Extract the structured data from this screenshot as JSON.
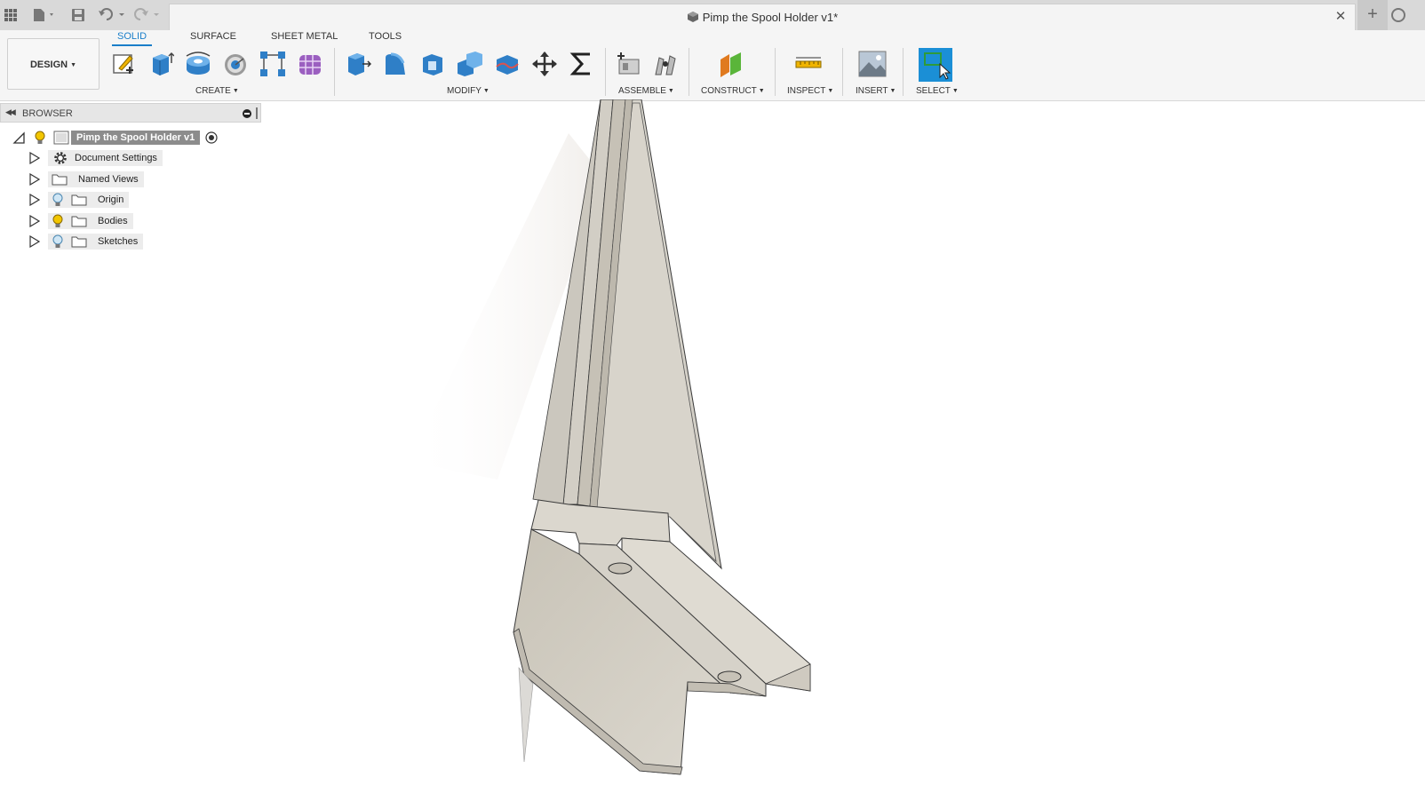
{
  "document": {
    "title": "Pimp the Spool Holder v1*",
    "close_glyph": "✕",
    "new_tab_glyph": "+"
  },
  "workspace": {
    "label": "DESIGN"
  },
  "ribbon": {
    "tabs": [
      {
        "label": "SOLID",
        "active": true
      },
      {
        "label": "SURFACE",
        "active": false
      },
      {
        "label": "SHEET METAL",
        "active": false
      },
      {
        "label": "TOOLS",
        "active": false
      }
    ],
    "groups": {
      "create": "CREATE",
      "modify": "MODIFY",
      "assemble": "ASSEMBLE",
      "construct": "CONSTRUCT",
      "inspect": "INSPECT",
      "insert": "INSERT",
      "select": "SELECT"
    },
    "accent_color": "#1a7ec9",
    "select_active_color": "#1b8fd6"
  },
  "browser": {
    "title": "BROWSER",
    "root": "Pimp the Spool Holder v1",
    "items": [
      {
        "label": "Document Settings",
        "icon": "gear-icon"
      },
      {
        "label": "Named Views",
        "icon": "folder-icon"
      },
      {
        "label": "Origin",
        "icon": "folder-icon"
      },
      {
        "label": "Bodies",
        "icon": "folder-icon"
      },
      {
        "label": "Sketches",
        "icon": "folder-icon"
      }
    ]
  }
}
